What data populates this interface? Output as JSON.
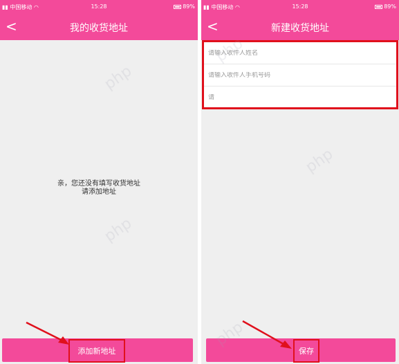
{
  "status_bar": {
    "carrier": "中国移动",
    "time": "15:28",
    "battery": "89%"
  },
  "left_screen": {
    "title": "我的收货地址",
    "empty_line1": "亲，您还没有填写收货地址",
    "empty_line2": "请添加地址",
    "add_button_label": "添加新地址"
  },
  "right_screen": {
    "title": "新建收货地址",
    "fields": [
      {
        "placeholder": "请输入收件人姓名"
      },
      {
        "placeholder": "请输入收件人手机号码"
      },
      {
        "placeholder": "请"
      }
    ],
    "save_button_label": "保存"
  },
  "watermark_text": "php",
  "colors": {
    "brand_pink": "#f34a9a",
    "highlight_red": "#e0101c",
    "background": "#efefef"
  }
}
